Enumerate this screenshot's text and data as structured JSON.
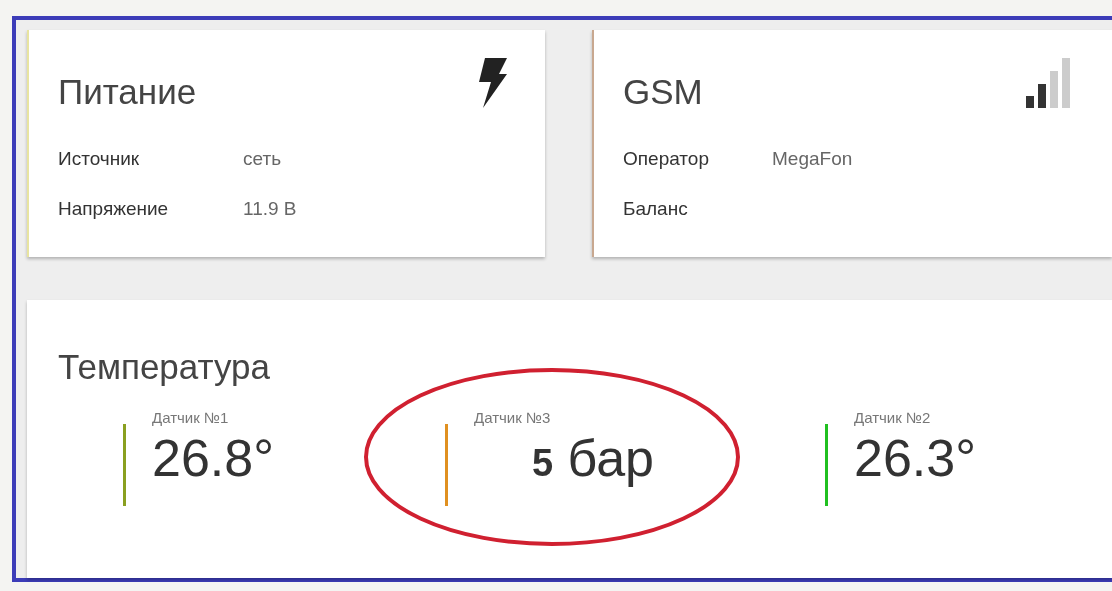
{
  "cards": [
    {
      "title": "Питание",
      "kind": "power",
      "color": "#e8e4a0",
      "rows": [
        {
          "label": "Источник",
          "value": "сеть"
        },
        {
          "label": "Напряжение",
          "value": "11.9 В"
        }
      ]
    },
    {
      "title": "GSM",
      "kind": "gsm",
      "color": "#c8a890",
      "rows": [
        {
          "label": "Оператор",
          "value": "MegaFon"
        },
        {
          "label": "Баланс"
        }
      ]
    }
  ],
  "temperature": {
    "title": "Температура",
    "sensors": [
      {
        "label": "Датчик №1",
        "value": "26.8°",
        "color": "#8aa020",
        "highlighted": false
      },
      {
        "label": "Датчик №3",
        "value": "**5**  бар",
        "color": "#e09020",
        "highlighted": true
      },
      {
        "label": "Датчик №2",
        "value": "26.3°",
        "color": "#20c020",
        "highlighted": false
      }
    ]
  }
}
